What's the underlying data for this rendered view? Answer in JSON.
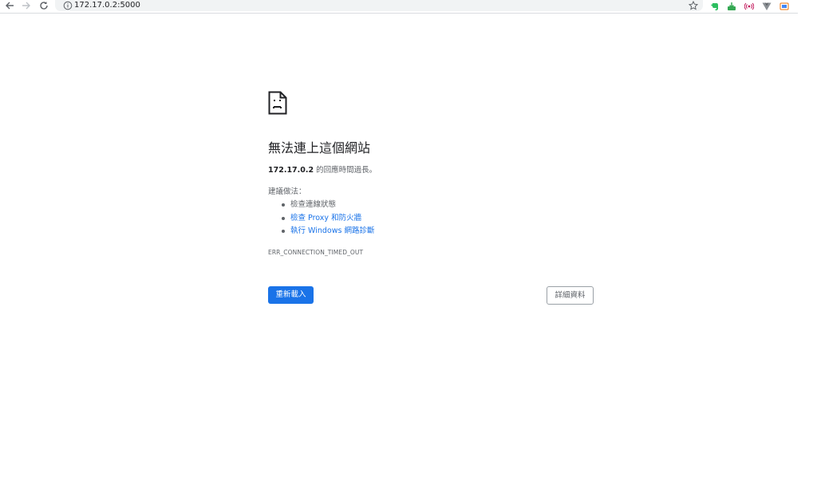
{
  "browser": {
    "url": "172.17.0.2:5000",
    "icons": {
      "back": "arrow-left-icon",
      "forward": "arrow-right-icon",
      "reload": "reload-icon",
      "info": "info-icon",
      "bookmark": "star-icon"
    },
    "extensions": [
      "evernote-icon",
      "download-icon",
      "cast-icon",
      "vue-devtools-icon",
      "screenshot-icon"
    ]
  },
  "error_page": {
    "title": "無法連上這個網站",
    "host": "172.17.0.2",
    "message": " 的回應時間過長。",
    "try_label": "建議做法：",
    "suggestions": [
      "檢查連線狀態",
      "檢查 Proxy 和防火牆",
      "執行 Windows 網路診斷"
    ],
    "error_code": "ERR_CONNECTION_TIMED_OUT",
    "reload_label": "重新載入",
    "details_label": "詳細資料"
  },
  "colors": {
    "accent": "#1a73e8",
    "text": "#202124",
    "secondary_text": "#5f6368"
  }
}
